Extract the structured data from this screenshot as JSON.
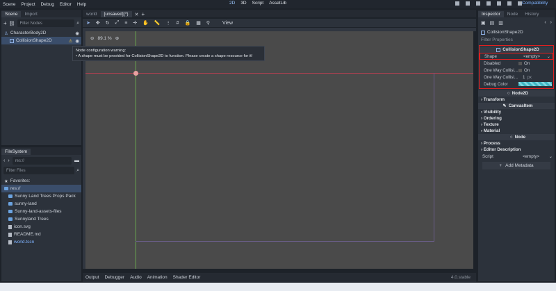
{
  "menu": [
    "Scene",
    "Project",
    "Debug",
    "Editor",
    "Help"
  ],
  "workspaces": [
    "2D",
    "3D",
    "Script",
    "AssetLib"
  ],
  "renderer": "Compatibility",
  "scene_panel": {
    "tabs": [
      "Scene",
      "Import"
    ],
    "filter_placeholder": "Filter Nodes",
    "nodes": [
      {
        "label": "CharacterBody2D"
      },
      {
        "label": "CollisionShape2D"
      }
    ]
  },
  "tooltip": {
    "title": "Node configuration warning:",
    "text": "• A shape must be provided for CollisionShape2D to function. Please create a shape resource for it!"
  },
  "editor_tabs": [
    "world",
    "[unsaved](*)"
  ],
  "viewport": {
    "zoom": "89.1 %",
    "view_label": "View"
  },
  "filesystem": {
    "title": "FileSystem",
    "path": "res://",
    "filter_placeholder": "Filter Files",
    "favorites_label": "Favorites:",
    "items": [
      {
        "label": "res://",
        "type": "folder"
      },
      {
        "label": "Sunny Land Trees Props Pack",
        "type": "folder"
      },
      {
        "label": "sunny-land",
        "type": "folder"
      },
      {
        "label": "Sunny-land-assets-files",
        "type": "folder"
      },
      {
        "label": "Sunnyland Trees",
        "type": "folder"
      },
      {
        "label": "icon.svg",
        "type": "file"
      },
      {
        "label": "README.md",
        "type": "file"
      },
      {
        "label": "world.tscn",
        "type": "file"
      }
    ]
  },
  "bottom_tabs": [
    "Output",
    "Debugger",
    "Audio",
    "Animation",
    "Shader Editor"
  ],
  "version": "4.0.stable",
  "inspector": {
    "tabs": [
      "Inspector",
      "Node",
      "History"
    ],
    "object_name": "CollisionShape2D",
    "filter_placeholder": "Filter Properties",
    "class_header": "CollisionShape2D",
    "props": [
      {
        "label": "Shape",
        "value": "<empty>"
      },
      {
        "label": "Disabled",
        "value": "On"
      },
      {
        "label": "One Way Collisi...",
        "value": "On"
      },
      {
        "label": "One Way Collisi...",
        "value": "1"
      },
      {
        "label": "Debug Color",
        "value": ""
      }
    ],
    "unit": "px",
    "node2d_header": "Node2D",
    "transform": "Transform",
    "canvas_header": "CanvasItem",
    "canvas_sections": [
      "Visibility",
      "Ordering",
      "Texture",
      "Material"
    ],
    "node_header": "Node",
    "node_sections": [
      "Process",
      "Editor Description"
    ],
    "script_label": "Script",
    "script_value": "<empty>",
    "add_metadata": "Add Metadata"
  },
  "colors": {
    "accent": "#4a8fe8",
    "warning_box": "#e02020",
    "debug_color": "#3fb5c2"
  }
}
